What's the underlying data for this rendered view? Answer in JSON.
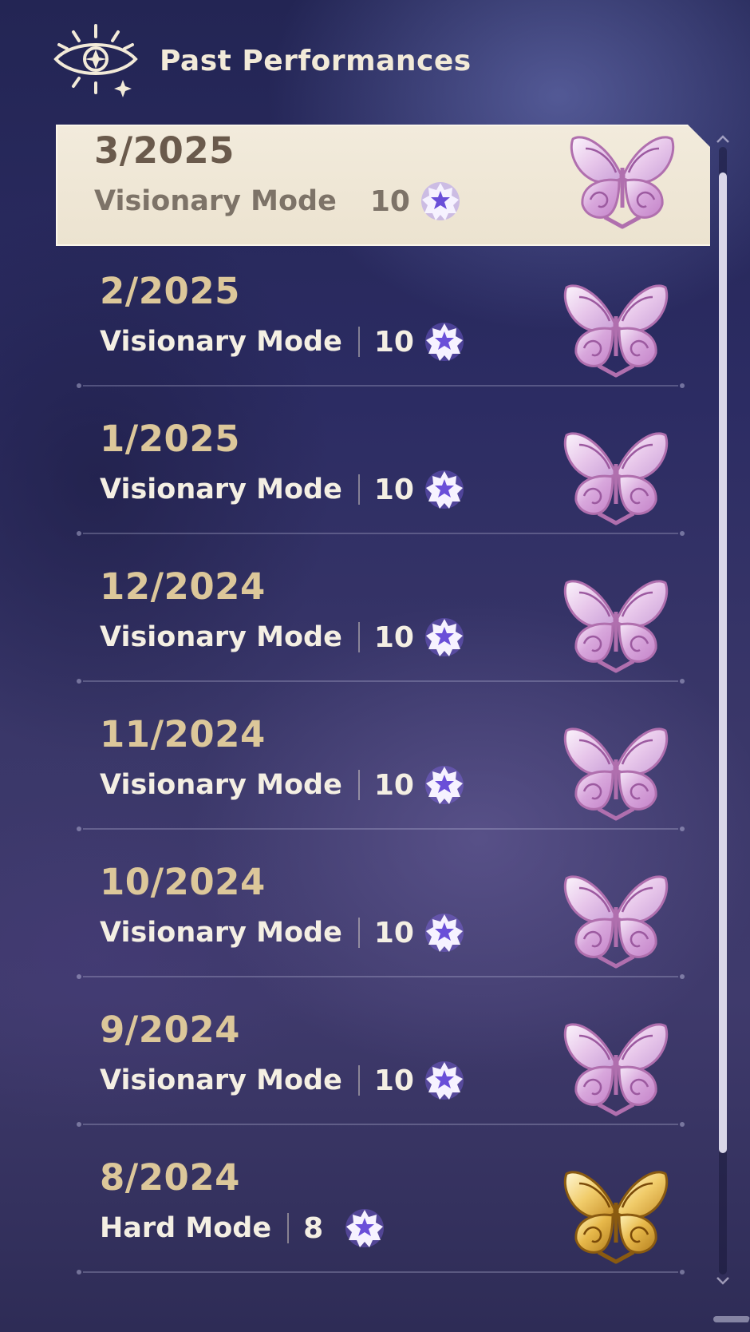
{
  "header": {
    "title": "Past Performances",
    "icon": "eye-sun-emblem-icon"
  },
  "entries": [
    {
      "date": "3/2025",
      "mode": "Visionary Mode",
      "stars": "10",
      "medal": "pink-butterfly-medal-icon",
      "selected": true
    },
    {
      "date": "2/2025",
      "mode": "Visionary Mode",
      "stars": "10",
      "medal": "pink-butterfly-medal-icon"
    },
    {
      "date": "1/2025",
      "mode": "Visionary Mode",
      "stars": "10",
      "medal": "pink-butterfly-medal-icon"
    },
    {
      "date": "12/2024",
      "mode": "Visionary Mode",
      "stars": "10",
      "medal": "pink-butterfly-medal-icon"
    },
    {
      "date": "11/2024",
      "mode": "Visionary Mode",
      "stars": "10",
      "medal": "pink-butterfly-medal-icon"
    },
    {
      "date": "10/2024",
      "mode": "Visionary Mode",
      "stars": "10",
      "medal": "pink-butterfly-medal-icon"
    },
    {
      "date": "9/2024",
      "mode": "Visionary Mode",
      "stars": "10",
      "medal": "pink-butterfly-medal-icon"
    },
    {
      "date": "8/2024",
      "mode": "Hard Mode",
      "stars": "8",
      "medal": "gold-butterfly-medal-icon"
    }
  ],
  "colors": {
    "date_gold": "#dcc79a",
    "text_light": "#f4efe3",
    "star_purple": "#6a4fd8",
    "selected_bg": "#f2ebdc"
  }
}
